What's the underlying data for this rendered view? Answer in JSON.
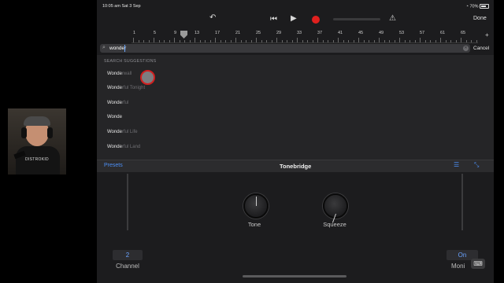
{
  "status_bar": {
    "time_date": "10:05 am   Sat 3 Sep",
    "battery": "70%"
  },
  "webcam": {
    "shirt_text": "DISTROKID"
  },
  "toolbar": {
    "undo_icon": "undo-icon",
    "rewind_icon": "rewind-icon",
    "play_icon": "play-icon",
    "record_icon": "record-icon",
    "metronome_icon": "metronome-icon",
    "done_label": "Done"
  },
  "ruler": {
    "marks": [
      "1",
      "5",
      "9",
      "13",
      "17",
      "21",
      "25",
      "29",
      "33",
      "37",
      "41",
      "45",
      "49",
      "53",
      "57",
      "61",
      "65"
    ],
    "add_label": "+"
  },
  "search": {
    "value": "wonder",
    "cancel_label": "Cancel"
  },
  "suggestions": {
    "header": "SEARCH SUGGESTIONS",
    "items": [
      {
        "typed": "Wonde",
        "rest": "rwall"
      },
      {
        "typed": "Wonde",
        "rest": "rful Tonight"
      },
      {
        "typed": "Wonde",
        "rest": "rful"
      },
      {
        "typed": "Wonde",
        "rest": ""
      },
      {
        "typed": "Wonde",
        "rest": "rful Life"
      },
      {
        "typed": "Wonde",
        "rest": "rful Land"
      }
    ]
  },
  "tonebridge": {
    "presets_label": "Presets",
    "title": "Tonebridge",
    "knobs": [
      {
        "label": "Tone"
      },
      {
        "label": "Squeeze"
      }
    ],
    "channel": {
      "value": "2",
      "label": "Channel"
    },
    "monitor": {
      "value": "On",
      "label": "Moni"
    }
  },
  "colors": {
    "accent": "#4c8ff5",
    "record": "#e0201e",
    "background": "#1c1c1e"
  }
}
